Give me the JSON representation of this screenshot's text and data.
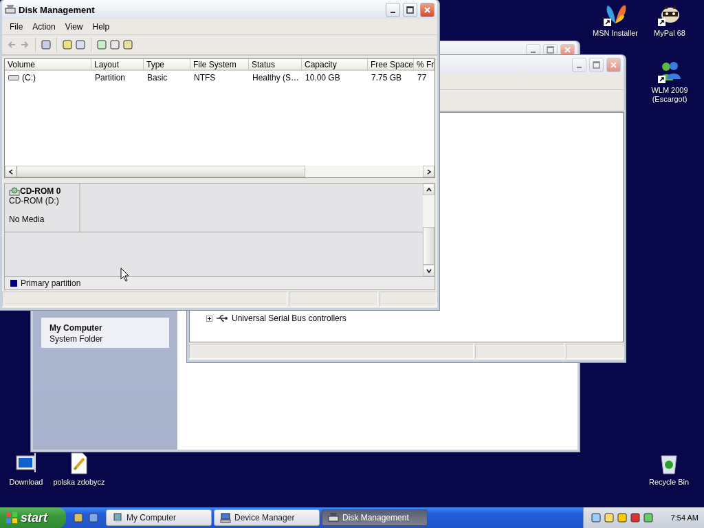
{
  "desktop_icons": [
    {
      "label": "MSN Installer",
      "kind": "butterfly",
      "shortcut": true
    },
    {
      "label": "MyPal 68",
      "kind": "raccoon",
      "shortcut": true
    },
    {
      "label": "WLM 2009 (Escargot)",
      "kind": "messenger",
      "shortcut": true
    },
    {
      "label": "Download",
      "kind": "monitor",
      "shortcut": false
    },
    {
      "label": "polska zdobycz",
      "kind": "document",
      "shortcut": false
    },
    {
      "label": "Recycle Bin",
      "kind": "recycle",
      "shortcut": false
    }
  ],
  "my_computer_window": {
    "details": {
      "title": "My Computer",
      "subtitle": "System Folder"
    }
  },
  "device_manager_window": {
    "tree": [
      {
        "label": "Universal Serial Bus controllers",
        "expanded": false
      }
    ]
  },
  "disk_management_window": {
    "title": "Disk Management",
    "menu": [
      "File",
      "Action",
      "View",
      "Help"
    ],
    "columns": [
      "Volume",
      "Layout",
      "Type",
      "File System",
      "Status",
      "Capacity",
      "Free Space",
      "% Fr"
    ],
    "rows": [
      {
        "cells": [
          "(C:)",
          "Partition",
          "Basic",
          "NTFS",
          "Healthy (S…",
          "10.00 GB",
          "7.75 GB",
          "77"
        ]
      }
    ],
    "disks": [
      {
        "name": "CD-ROM 0",
        "drive": "CD-ROM (D:)",
        "status": "No Media"
      }
    ],
    "legend": [
      {
        "label": "Primary partition",
        "color": "#000080"
      }
    ]
  },
  "taskbar": {
    "start": "start",
    "tasks": [
      {
        "label": "My Computer",
        "kind": "computer",
        "selected": false
      },
      {
        "label": "Device Manager",
        "kind": "device",
        "selected": false
      },
      {
        "label": "Disk Management",
        "kind": "disk",
        "selected": true
      }
    ],
    "clock": "7:54 AM"
  }
}
